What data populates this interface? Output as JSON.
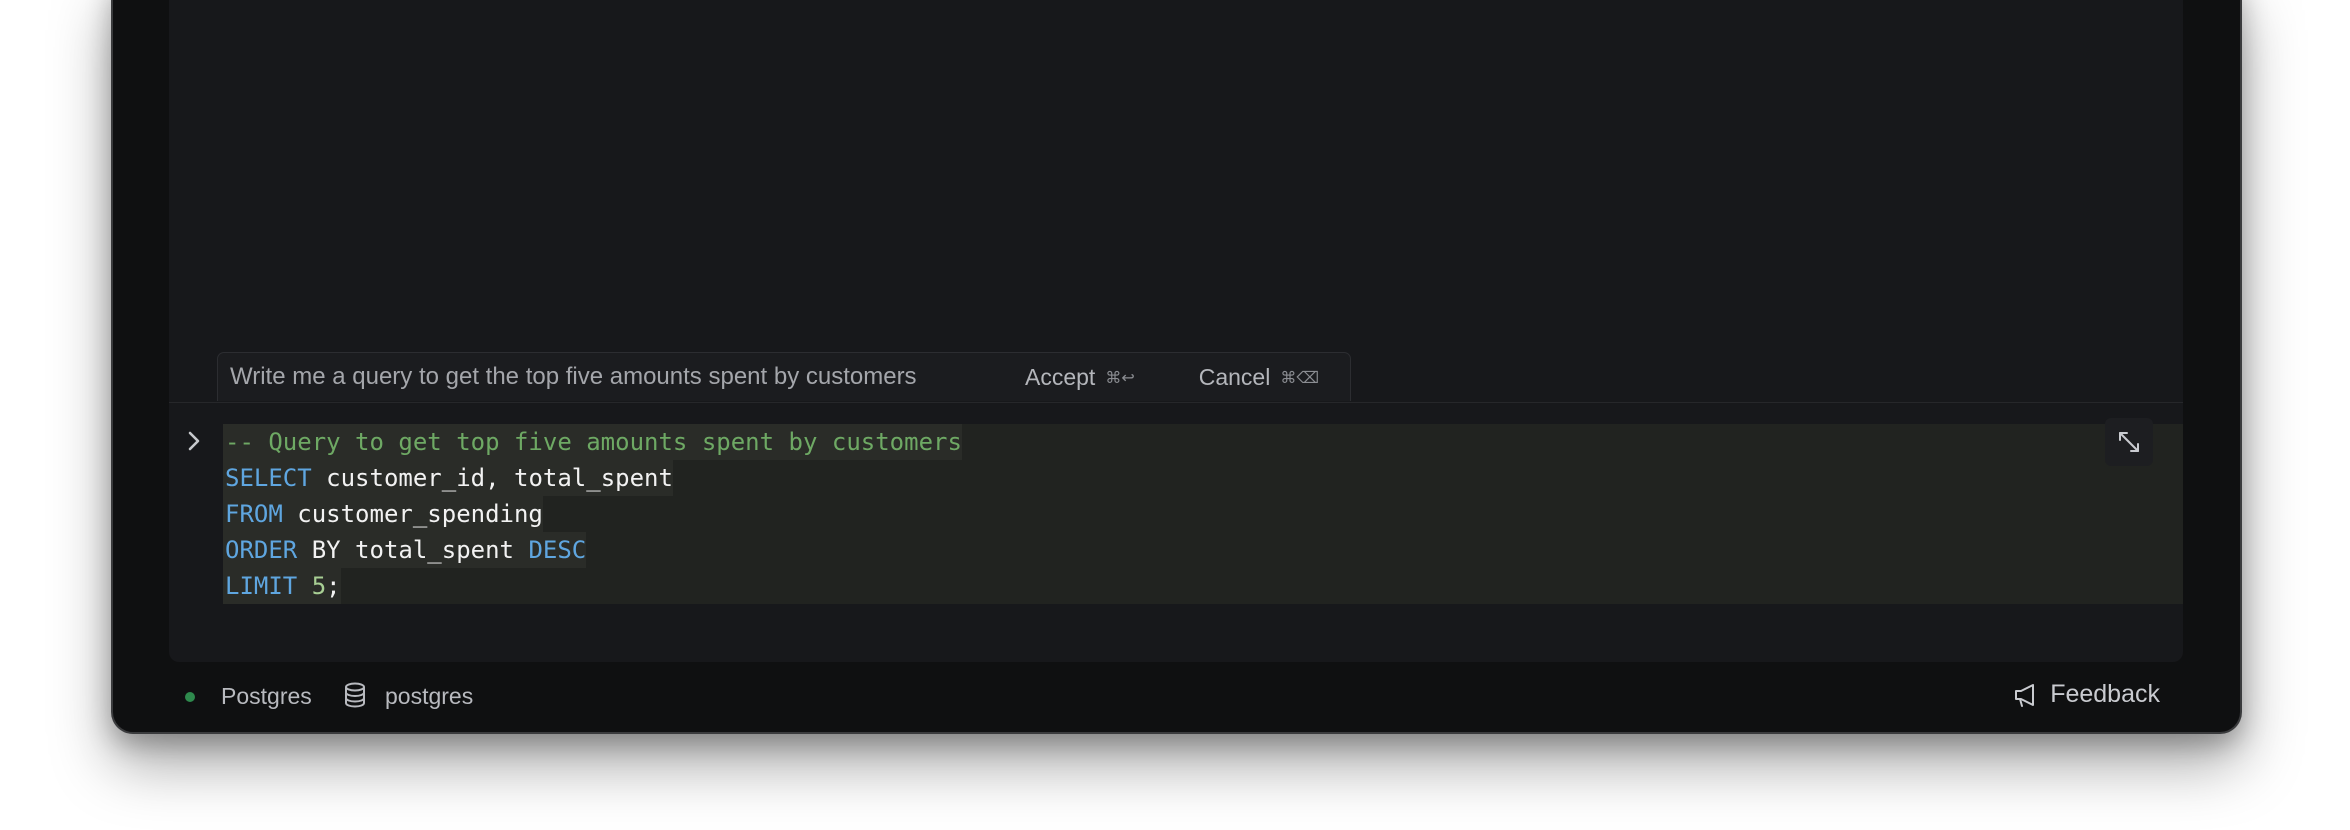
{
  "prompt": {
    "value": "Write me a query to get the top five amounts spent by customers",
    "accept_label": "Accept",
    "accept_shortcut": "⌘↩",
    "cancel_label": "Cancel",
    "cancel_shortcut": "⌘⌫"
  },
  "editor": {
    "lines": [
      "-- Query to get top five amounts spent by customers",
      "SELECT customer_id, total_spent",
      "FROM customer_spending",
      "ORDER BY total_spent DESC",
      "LIMIT 5;"
    ]
  },
  "status": {
    "connection_label": "Postgres",
    "database_label": "postgres",
    "feedback_label": "Feedback",
    "connection_color": "#2e8a4d"
  },
  "icons": {
    "run": "chevron-right-icon",
    "expand": "expand-icon",
    "database": "database-icon",
    "feedback": "megaphone-icon"
  }
}
